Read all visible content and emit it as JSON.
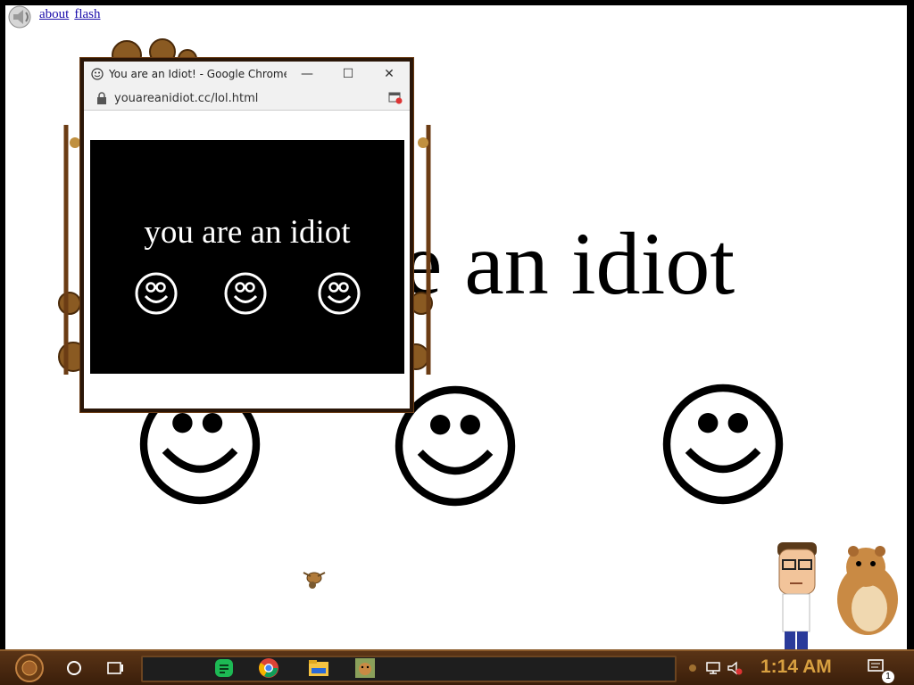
{
  "page": {
    "links": [
      "about",
      "flash"
    ],
    "big_phrase_visible": "e an idiot",
    "smiley_count": 3
  },
  "popup": {
    "window_title": "You are an Idiot! - Google Chrome",
    "url": "youareanidiot.cc/lol.html",
    "buttons": {
      "minimize": "—",
      "maximize": "☐",
      "close": "✕"
    },
    "phrase": "you are an idiot"
  },
  "taskbar": {
    "pinned_apps": [
      "cortana-circle",
      "task-view",
      "green-app",
      "chrome",
      "file-explorer",
      "hamster-app"
    ],
    "clock": "1:14 AM",
    "notification_count": "1"
  },
  "colors": {
    "page_bg": "#ffffff",
    "stage_bg": "#000000",
    "taskbar_accent": "#d8a040",
    "frame_copper": "#6b3c14"
  }
}
